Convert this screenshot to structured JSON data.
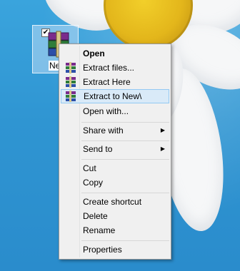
{
  "desktop": {
    "icon_label": "Ne",
    "icon_check": "✔",
    "icon_name": "winrar-archive-icon"
  },
  "menu": {
    "items": [
      {
        "label": "Open",
        "bold": true
      },
      {
        "label": "Extract files...",
        "icon": "winrar-icon"
      },
      {
        "label": "Extract Here",
        "icon": "winrar-icon"
      },
      {
        "label": "Extract to New\\",
        "icon": "winrar-icon",
        "highlighted": true
      },
      {
        "label": "Open with..."
      },
      {
        "label": "Share with",
        "submenu": true
      },
      {
        "label": "Send to",
        "submenu": true
      },
      {
        "label": "Cut"
      },
      {
        "label": "Copy"
      },
      {
        "label": "Create shortcut"
      },
      {
        "label": "Delete"
      },
      {
        "label": "Rename"
      },
      {
        "label": "Properties"
      }
    ],
    "submenu_arrow": "▶",
    "colors": {
      "highlight_bg": "#d9eaf8",
      "highlight_border": "#93c9f2",
      "menu_bg": "#f0f0f0"
    }
  }
}
